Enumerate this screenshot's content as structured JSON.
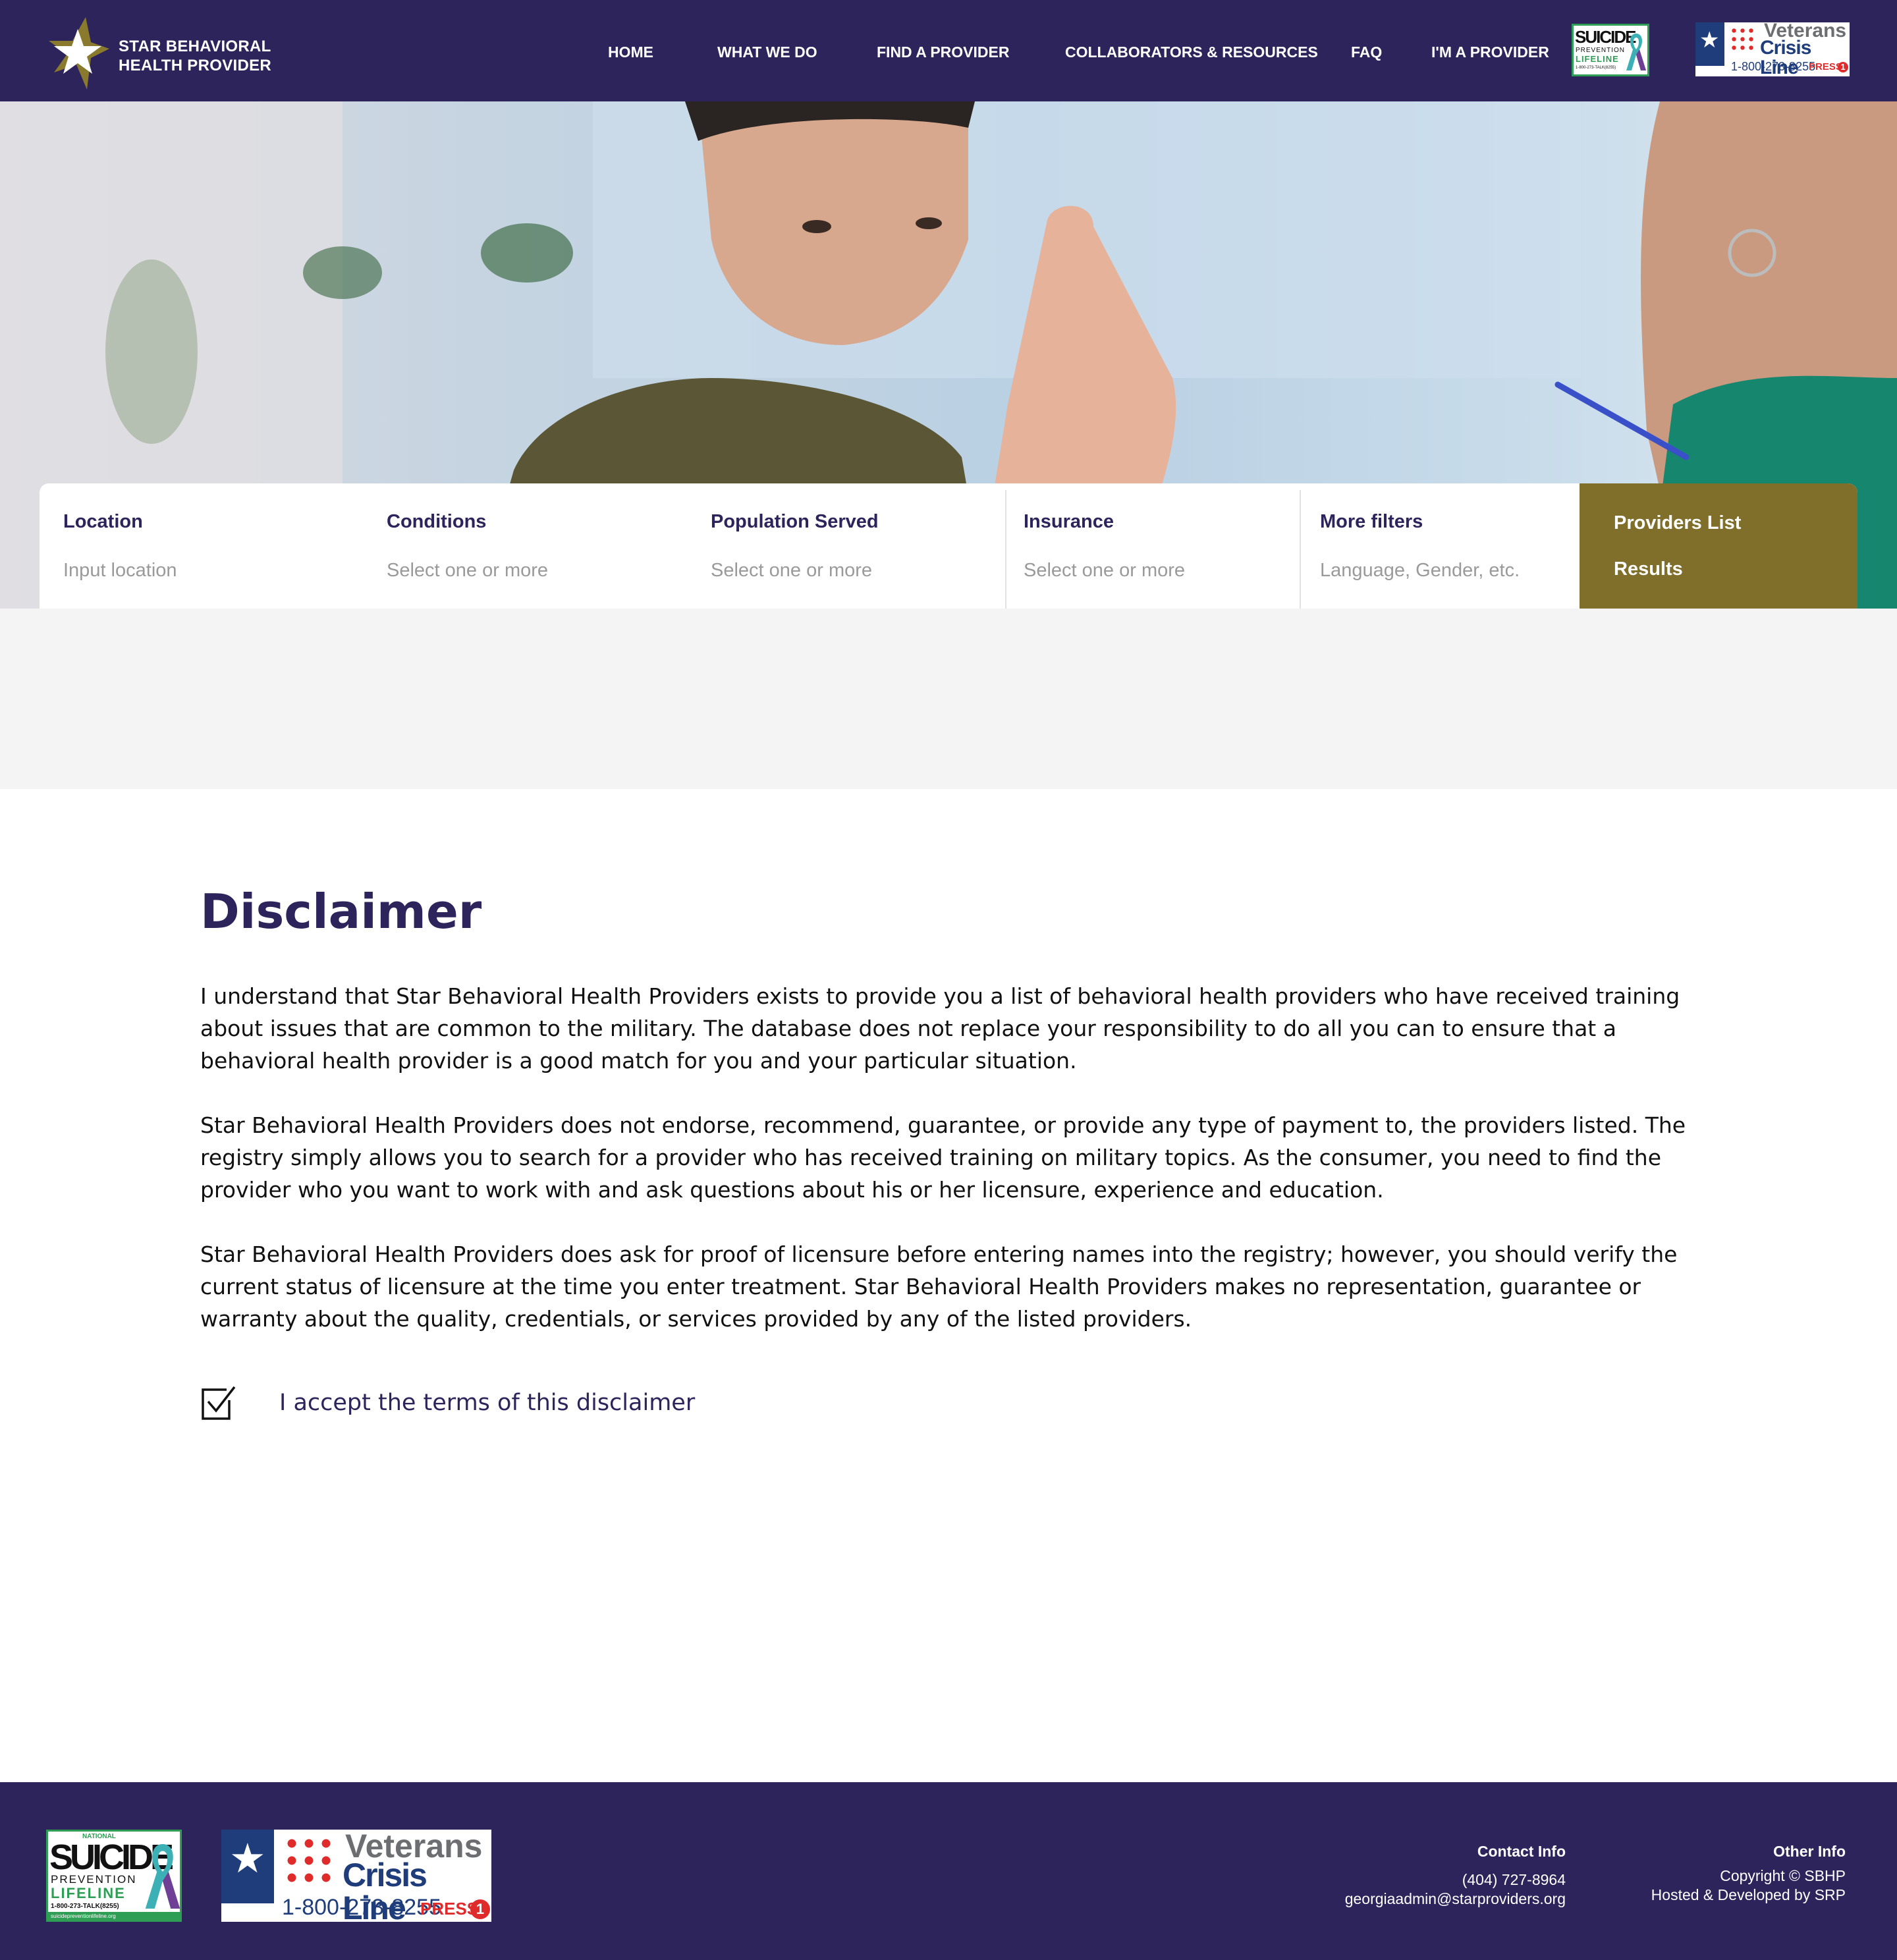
{
  "header": {
    "brand_line1": "STAR BEHAVIORAL",
    "brand_line2": "HEALTH PROVIDER",
    "nav": [
      "HOME",
      "WHAT WE DO",
      "FIND A PROVIDER",
      "COLLABORATORS & RESOURCES",
      "FAQ",
      "I'M A PROVIDER"
    ],
    "badge_suicide": {
      "word": "SUICIDE",
      "sub": "PREVENTION",
      "lifeline": "LIFELINE",
      "phone": "1-800-273-TALK(8255)"
    },
    "badge_vets": {
      "line1": "Veterans",
      "line2": "Crisis Line",
      "phone": "1-800-273-8255",
      "press": "PRESS",
      "press_num": "1"
    }
  },
  "filters": [
    {
      "label": "Location",
      "hint": "Input location"
    },
    {
      "label": "Conditions",
      "hint": "Select one or more"
    },
    {
      "label": "Population Served",
      "hint": "Select one or more"
    },
    {
      "label": "Insurance",
      "hint": "Select one or more"
    },
    {
      "label": "More filters",
      "hint": "Language, Gender, etc."
    }
  ],
  "results": {
    "line1": "Providers List",
    "line2": "Results"
  },
  "disclaimer": {
    "title": "Disclaimer",
    "paragraphs": [
      "I understand that Star Behavioral Health Providers exists to provide you a list of behavioral health providers  who have received training about issues that are common to the military. The database does not replace your responsibility to do all you can to ensure that a behavioral health provider is a good match for you and your particular situation.",
      "Star Behavioral Health Providers does not endorse, recommend, guarantee, or provide any type of payment to, the providers listed. The registry simply allows you to search for a provider who has received training on military topics. As the consumer, you need to find the provider who you want to work with and ask questions about his or her licensure, experience and education.",
      "Star Behavioral Health Providers does ask for proof of licensure before entering names into the registry; however, you should verify the current status of licensure at the time you enter treatment. Star Behavioral Health Providers makes no representation, guarantee or warranty about the quality, credentials, or services provided by any of the listed providers."
    ],
    "accept_label": "I accept the terms of this disclaimer",
    "accept_checked": true
  },
  "footer": {
    "badge_suicide": {
      "top": "NATIONAL",
      "word": "SUICIDE",
      "sub": "PREVENTION",
      "lifeline": "LIFELINE",
      "phone": "1-800-273-TALK(8255)",
      "url": "suicidepreventionlifeline.org"
    },
    "badge_vets": {
      "line1": "Veterans",
      "line2": "Crisis Line",
      "phone": "1-800-273-8255",
      "press": "PRESS",
      "press_num": "1"
    },
    "contact": {
      "heading": "Contact Info",
      "phone": "(404) 727-8964",
      "email": "georgiaadmin@starproviders.org"
    },
    "other": {
      "heading": "Other Info",
      "copyright": "Copyright © SBHP",
      "hosted": "Hosted & Developed by SRP"
    }
  },
  "colors": {
    "navy": "#2e245c",
    "gold": "#7f6f2a",
    "gray_band": "#f4f4f4"
  },
  "icons": [
    "star-logo-icon",
    "checkbox-checked-icon",
    "awareness-ribbon-icon",
    "flag-star-icon"
  ]
}
